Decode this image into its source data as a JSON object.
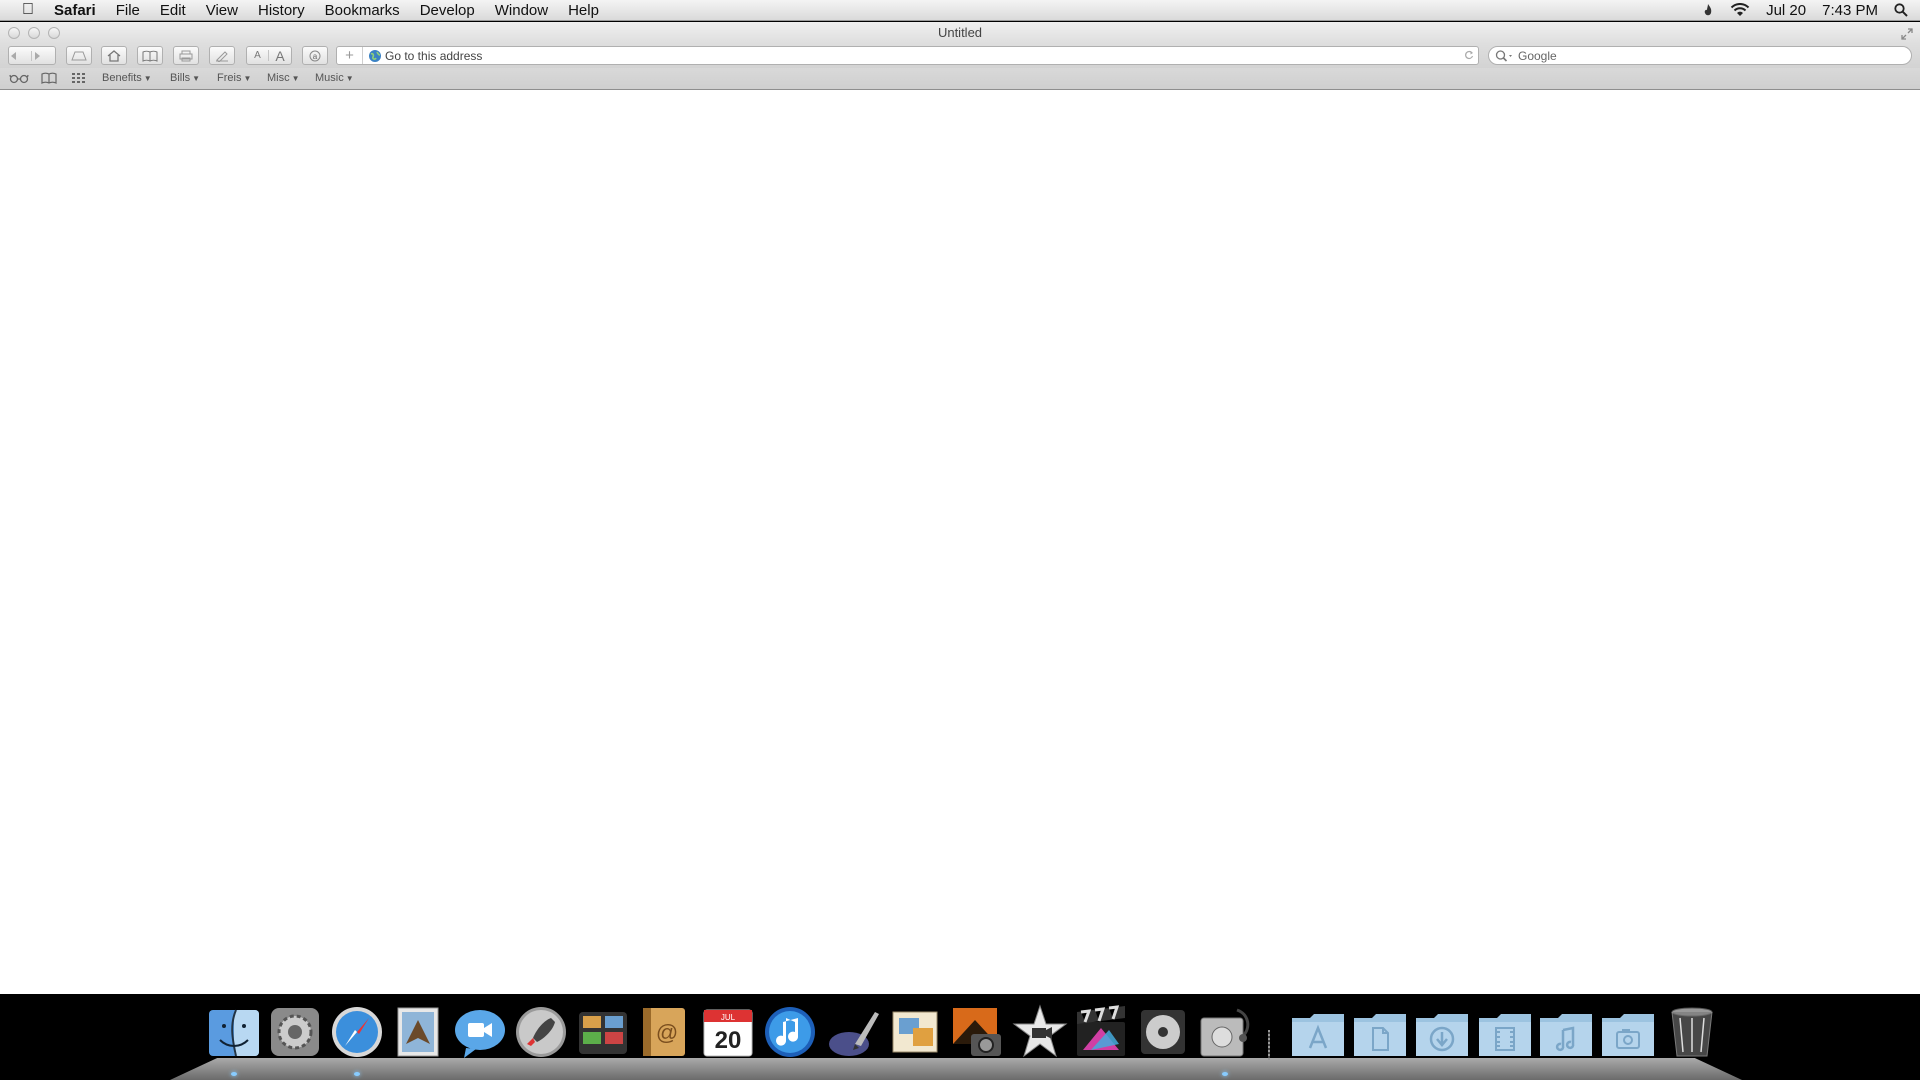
{
  "menubar": {
    "app_name": "Safari",
    "items": [
      "File",
      "Edit",
      "View",
      "History",
      "Bookmarks",
      "Develop",
      "Window",
      "Help"
    ],
    "date": "Jul 20",
    "time": "7:43 PM"
  },
  "window": {
    "title": "Untitled"
  },
  "toolbar": {
    "font_small": "A",
    "font_large": "A",
    "address_placeholder": "Go to this address",
    "search_placeholder": "Google"
  },
  "bookmarks": {
    "folders": [
      "Benefits",
      "Bills",
      "Freis",
      "Misc",
      "Music"
    ]
  },
  "dock": {
    "calendar_month": "JUL",
    "calendar_day": "20",
    "apps": [
      "Finder",
      "System Preferences",
      "Safari",
      "Mail",
      "FaceTime",
      "Launchpad",
      "Photo Browser",
      "Address Book",
      "iCal",
      "iTunes",
      "Script Editor",
      "Preview",
      "Image Capture",
      "iMovie",
      "Final Cut Pro",
      "DVD Player",
      "Disk Utility",
      "Applications",
      "Documents",
      "Downloads",
      "Movies",
      "Music",
      "Pictures",
      "Trash"
    ]
  },
  "colors": {
    "accent": "#3b82c4",
    "menubar": "#e6e6e6",
    "dock_folder": "#9cc3e0"
  }
}
